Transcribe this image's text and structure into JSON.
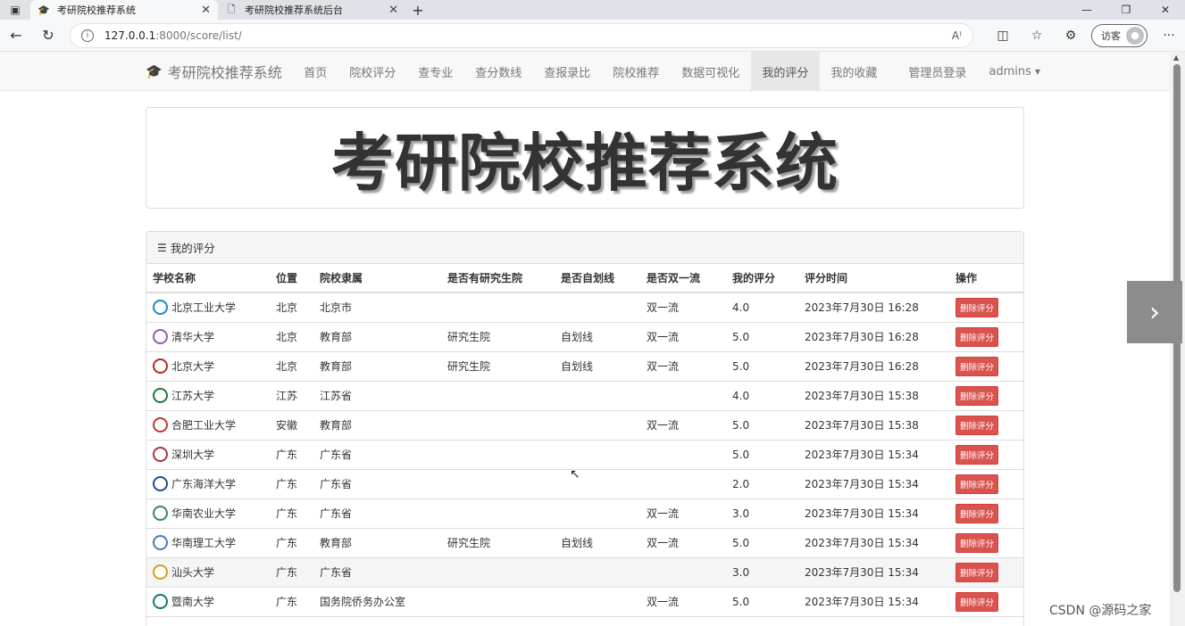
{
  "browser": {
    "tabs": [
      {
        "title": "考研院校推荐系统",
        "close": "✕"
      },
      {
        "title": "考研院校推荐系统后台",
        "close": "✕"
      }
    ],
    "url_host": "127.0.0.1",
    "url_path": ":8000/score/list/",
    "profile_label": "访客"
  },
  "nav": {
    "brand": "考研院校推荐系统",
    "items": [
      "首页",
      "院校评分",
      "查专业",
      "查分数线",
      "查报录比",
      "院校推荐",
      "数据可视化",
      "我的评分",
      "我的收藏",
      "管理员登录",
      "admins"
    ]
  },
  "jumbo": {
    "title": "考研院校推荐系统"
  },
  "panel": {
    "title": "我的评分",
    "columns": [
      "学校名称",
      "位置",
      "院校隶属",
      "是否有研究生院",
      "是否自划线",
      "是否双一流",
      "我的评分",
      "评分时间",
      "操作"
    ],
    "delete_label": "删除评分",
    "rows": [
      {
        "name": "北京工业大学",
        "loc": "北京",
        "affil": "北京市",
        "grad": "",
        "self": "",
        "dbl": "双一流",
        "score": "4.0",
        "time": "2023年7月30日 16:28",
        "color": "#1e88c7"
      },
      {
        "name": "清华大学",
        "loc": "北京",
        "affil": "教育部",
        "grad": "研究生院",
        "self": "自划线",
        "dbl": "双一流",
        "score": "5.0",
        "time": "2023年7月30日 16:28",
        "color": "#8e5fa8"
      },
      {
        "name": "北京大学",
        "loc": "北京",
        "affil": "教育部",
        "grad": "研究生院",
        "self": "自划线",
        "dbl": "双一流",
        "score": "5.0",
        "time": "2023年7月30日 16:28",
        "color": "#b22a2a"
      },
      {
        "name": "江苏大学",
        "loc": "江苏",
        "affil": "江苏省",
        "grad": "",
        "self": "",
        "dbl": "",
        "score": "4.0",
        "time": "2023年7月30日 15:38",
        "color": "#1f7a3a"
      },
      {
        "name": "合肥工业大学",
        "loc": "安徽",
        "affil": "教育部",
        "grad": "",
        "self": "",
        "dbl": "双一流",
        "score": "5.0",
        "time": "2023年7月30日 15:38",
        "color": "#c0392b"
      },
      {
        "name": "深圳大学",
        "loc": "广东",
        "affil": "广东省",
        "grad": "",
        "self": "",
        "dbl": "",
        "score": "5.0",
        "time": "2023年7月30日 15:34",
        "color": "#a8324a"
      },
      {
        "name": "广东海洋大学",
        "loc": "广东",
        "affil": "广东省",
        "grad": "",
        "self": "",
        "dbl": "",
        "score": "2.0",
        "time": "2023年7月30日 15:34",
        "color": "#1c4f8a"
      },
      {
        "name": "华南农业大学",
        "loc": "广东",
        "affil": "广东省",
        "grad": "",
        "self": "",
        "dbl": "双一流",
        "score": "3.0",
        "time": "2023年7月30日 15:34",
        "color": "#2e8b57"
      },
      {
        "name": "华南理工大学",
        "loc": "广东",
        "affil": "教育部",
        "grad": "研究生院",
        "self": "自划线",
        "dbl": "双一流",
        "score": "5.0",
        "time": "2023年7月30日 15:34",
        "color": "#3f7fc4"
      },
      {
        "name": "汕头大学",
        "loc": "广东",
        "affil": "广东省",
        "grad": "",
        "self": "",
        "dbl": "",
        "score": "3.0",
        "time": "2023年7月30日 15:34",
        "color": "#d4a017"
      },
      {
        "name": "暨南大学",
        "loc": "广东",
        "affil": "国务院侨务办公室",
        "grad": "",
        "self": "",
        "dbl": "双一流",
        "score": "5.0",
        "time": "2023年7月30日 15:34",
        "color": "#137a6e"
      }
    ]
  },
  "watermark": "CSDN @源码之家"
}
